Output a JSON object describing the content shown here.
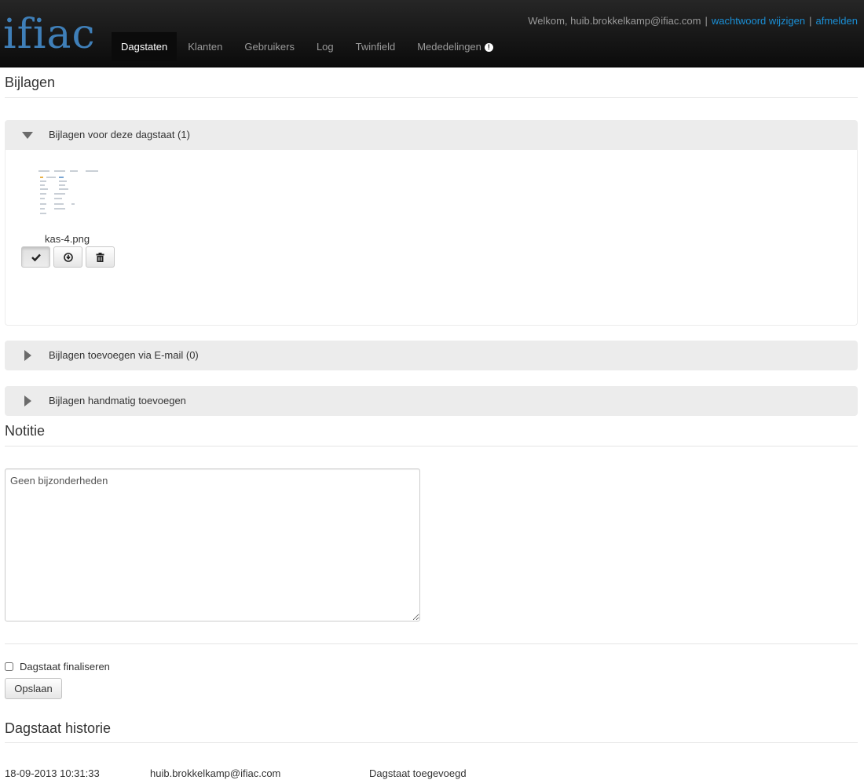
{
  "app": {
    "logo": "ifiac"
  },
  "nav": {
    "items": [
      {
        "label": "Dagstaten",
        "active": true
      },
      {
        "label": "Klanten"
      },
      {
        "label": "Gebruikers"
      },
      {
        "label": "Log"
      },
      {
        "label": "Twinfield"
      },
      {
        "label": "Mededelingen"
      }
    ]
  },
  "user": {
    "welcome": "Welkom, huib.brokkelkamp@ifiac.com",
    "change_password": "wachtwoord wijzigen",
    "logout": "afmelden",
    "separator": "|"
  },
  "attachments": {
    "title": "Bijlagen",
    "panels": [
      {
        "label": "Bijlagen voor deze dagstaat (1)",
        "expanded": true
      },
      {
        "label": "Bijlagen toevoegen via E-mail (0)",
        "expanded": false
      },
      {
        "label": "Bijlagen handmatig toevoegen",
        "expanded": false
      }
    ],
    "files": [
      {
        "name": "kas-4.png"
      }
    ]
  },
  "note": {
    "title": "Notitie",
    "value": "Geen bijzonderheden"
  },
  "finalize": {
    "label": "Dagstaat finaliseren",
    "checked": false
  },
  "save_label": "Opslaan",
  "history": {
    "title": "Dagstaat historie",
    "rows": [
      {
        "timestamp": "18-09-2013 10:31:33",
        "user": "huib.brokkelkamp@ifiac.com",
        "action": "Dagstaat toegevoegd"
      }
    ]
  },
  "colors": {
    "logo": "#3f7fb8",
    "link": "#1a8fd6",
    "topbar": "#1a1a1a",
    "panel": "#ececec"
  }
}
